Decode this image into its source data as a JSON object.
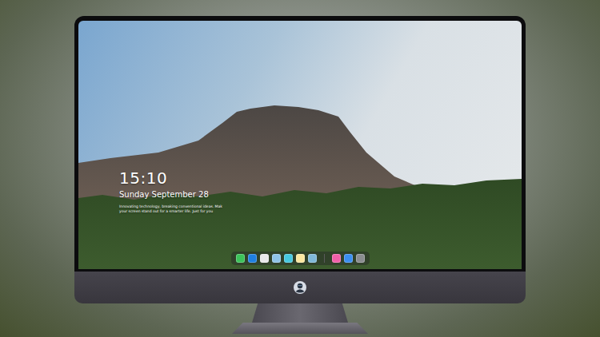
{
  "lock_screen": {
    "time": "15:10",
    "date": "Sunday September 28",
    "caption": [
      "Innovating technology, breaking conventional ideas. Mak",
      "your screen stand out for a smarter life. Just for you"
    ]
  },
  "dock": {
    "items": [
      {
        "kind": "app",
        "color": "#3cc25a"
      },
      {
        "kind": "app",
        "color": "#1f7fe0"
      },
      {
        "kind": "app",
        "color": "#e8e8ea"
      },
      {
        "kind": "app",
        "color": "#8fc3e8"
      },
      {
        "kind": "app",
        "color": "#46c8e0"
      },
      {
        "kind": "app",
        "color": "#fbe7a0"
      },
      {
        "kind": "app",
        "color": "#7fb8d8"
      },
      {
        "kind": "separator",
        "color": "#5a5a5a"
      },
      {
        "kind": "app",
        "color": "#f05fa8"
      },
      {
        "kind": "app",
        "color": "#3a8ef0"
      },
      {
        "kind": "app",
        "color": "#8a8c90"
      }
    ]
  }
}
